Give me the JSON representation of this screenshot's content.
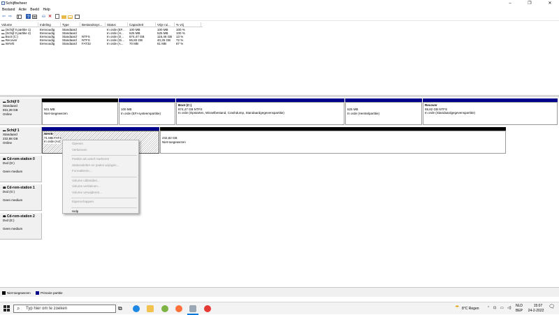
{
  "window": {
    "title": "Schijfbeheer",
    "min": "–",
    "max": "❐",
    "close": "✕"
  },
  "menu": [
    "Bestand",
    "Actie",
    "Beeld",
    "Help"
  ],
  "volumes": {
    "headers": [
      "Volume",
      "Indeling",
      "Type",
      "Bestandssys...",
      "Status",
      "Capaciteit",
      "Vrije rui...",
      "% vrij"
    ],
    "rows": [
      [
        "(Schijf 0 partitie 1)",
        "Eenvoudig",
        "Standaard",
        "",
        "In orde (EF...",
        "100 MB",
        "100 MB",
        "100 %"
      ],
      [
        "(Schijf 0 partitie 4)",
        "Eenvoudig",
        "Standaard",
        "",
        "In orde (H...",
        "525 MB",
        "525 MB",
        "100 %"
      ],
      [
        "Boot (C:)",
        "Eenvoudig",
        "Standaard",
        "NTFS",
        "In orde (O...",
        "874,47 GB",
        "115,46 GB",
        "13 %"
      ],
      [
        "Recover",
        "Eenvoudig",
        "Standaard",
        "NTFS",
        "In orde (Gi...",
        "55,82 GB",
        "40,25 GB",
        "72 %"
      ],
      [
        "WAVE",
        "Eenvoudig",
        "Standaard",
        "FAT32",
        "In orde (A...",
        "70 MB",
        "61 MB",
        "87 %"
      ]
    ]
  },
  "disk0": {
    "name": "Schijf 0",
    "type": "Standaard",
    "size": "931,39 GB",
    "state": "Online",
    "partitions": [
      {
        "title": "",
        "line1": "501 MB",
        "line2": "Niet-toegewezen"
      },
      {
        "title": "",
        "line1": "100 MB",
        "line2": "In orde (EFI-systeempartitie)"
      },
      {
        "title": "Boot (C:)",
        "line1": "874,47 GB NTFS",
        "line2": "In orde (Opstarten, Wisselbestand, Crashdump, Standaardgegevenspartitie)"
      },
      {
        "title": "",
        "line1": "525 MB",
        "line2": "In orde (Herstelpartitie)"
      },
      {
        "title": "Recover",
        "line1": "55,82 GB NTFS",
        "line2": "In orde (Standaardgegevenspartitie)"
      }
    ]
  },
  "disk1": {
    "name": "Schijf 1",
    "type": "Standaard",
    "size": "232,88 GB",
    "state": "Online",
    "partitions": [
      {
        "title": "WAVE",
        "line1": "71 MB FAT3",
        "line2": "In orde (Act"
      },
      {
        "title": "",
        "line1": "232,82 GB",
        "line2": "Niet-toegewezen"
      }
    ]
  },
  "cdroms": [
    {
      "name": "Cd-rom-station 0",
      "drive": "Dvd (D:)",
      "media": "Geen medium"
    },
    {
      "name": "Cd-rom-station 1",
      "drive": "Dvd (G:)",
      "media": "Geen medium"
    },
    {
      "name": "Cd-rom-station 2",
      "drive": "Dvd (E:)",
      "media": "Geen medium"
    }
  ],
  "context_menu": [
    {
      "label": "Openen",
      "enabled": false
    },
    {
      "label": "Verkennen",
      "enabled": false
    },
    {
      "sep": true
    },
    {
      "label": "Partitie als actief markeren",
      "enabled": false
    },
    {
      "label": "Stationsletter en paden wijzigen...",
      "enabled": false
    },
    {
      "label": "Formatteren...",
      "enabled": false
    },
    {
      "sep": true
    },
    {
      "label": "Volume uitbreiden...",
      "enabled": false
    },
    {
      "label": "Volume verkleinen...",
      "enabled": false
    },
    {
      "label": "Volume verwijderen...",
      "enabled": false
    },
    {
      "sep": true
    },
    {
      "label": "Eigenschappen",
      "enabled": false
    },
    {
      "sep": true
    },
    {
      "label": "Help",
      "enabled": true
    }
  ],
  "legend": {
    "unallocated": "Niet-toegewezen",
    "primary": "Primaire partitie"
  },
  "taskbar": {
    "search_placeholder": "Typ hier om te zoeken",
    "weather": "8°C  Regen",
    "lang1": "NLD",
    "lang2": "BEP",
    "time": "15:07",
    "date": "24-2-2022"
  },
  "colors": {
    "primary": "#00008b",
    "unallocated": "#000000",
    "accent": "#0078d7"
  }
}
